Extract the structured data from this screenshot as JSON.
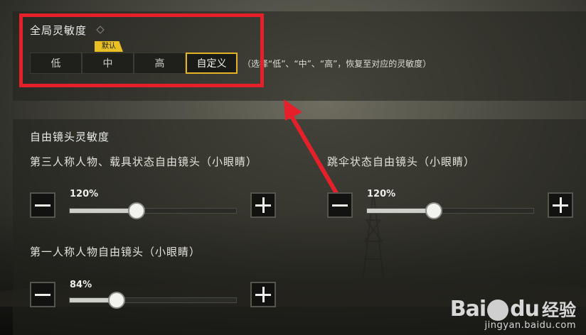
{
  "global_sensitivity": {
    "title": "全局灵敏度",
    "default_tag": "默认",
    "options": [
      "低",
      "中",
      "高",
      "自定义"
    ],
    "selected_index": 3,
    "hint": "（选择“低”、“中”、“高”，恢复至对应的灵敏度）"
  },
  "free_camera": {
    "title": "自由镜头灵敏度",
    "sliders": [
      {
        "label": "第三人称人物、载具状态自由镜头（小眼睛）",
        "value_text": "120%",
        "value": 0.4
      },
      {
        "label": "跳伞状态自由镜头（小眼睛）",
        "value_text": "120%",
        "value": 0.4
      },
      {
        "label": "第一人称人物自由镜头（小眼睛）",
        "value_text": "84%",
        "value": 0.28
      }
    ]
  },
  "watermark": {
    "logo_left": "Bai",
    "logo_right": "du",
    "logo_cn": "经验",
    "url": "jingyan.baidu.com"
  },
  "colors": {
    "accent": "#e4b325",
    "highlight_box": "#e5202a"
  }
}
